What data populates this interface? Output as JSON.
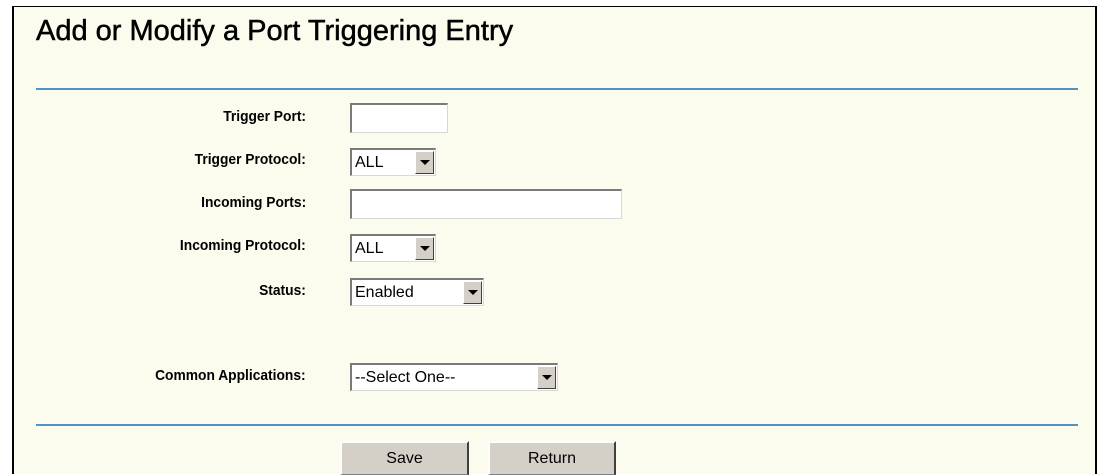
{
  "page": {
    "title": "Add or Modify a Port Triggering Entry"
  },
  "form": {
    "trigger_port": {
      "label": "Trigger Port:",
      "value": ""
    },
    "trigger_protocol": {
      "label": "Trigger Protocol:",
      "value": "ALL"
    },
    "incoming_ports": {
      "label": "Incoming Ports:",
      "value": ""
    },
    "incoming_protocol": {
      "label": "Incoming Protocol:",
      "value": "ALL"
    },
    "status": {
      "label": "Status:",
      "value": "Enabled"
    },
    "common_applications": {
      "label": "Common Applications:",
      "value": "--Select One--"
    }
  },
  "buttons": {
    "save": "Save",
    "return": "Return"
  },
  "colors": {
    "panel_background": "#fbfbee",
    "rule": "#4f94c4",
    "button_face": "#d4d0c8"
  },
  "icons": {
    "dropdown": "chevron-down-icon"
  }
}
